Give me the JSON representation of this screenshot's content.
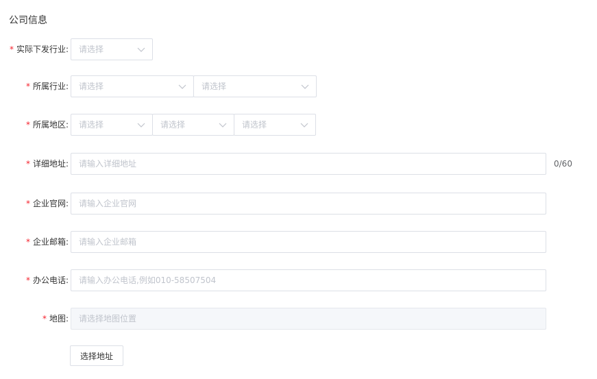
{
  "section": {
    "title": "公司信息"
  },
  "required_mark": "*",
  "industry_actual": {
    "label": "实际下发行业:",
    "select_placeholder": "请选择"
  },
  "industry": {
    "label": "所属行业:",
    "select1_placeholder": "请选择",
    "select2_placeholder": "请选择"
  },
  "region": {
    "label": "所属地区:",
    "select1_placeholder": "请选择",
    "select2_placeholder": "请选择",
    "select3_placeholder": "请选择"
  },
  "address": {
    "label": "详细地址:",
    "placeholder": "请输入详细地址",
    "counter": "0/60"
  },
  "website": {
    "label": "企业官网:",
    "placeholder": "请输入企业官网"
  },
  "email": {
    "label": "企业邮箱:",
    "placeholder": "请输入企业邮箱"
  },
  "phone": {
    "label": "办公电话:",
    "placeholder": "请输入办公电话,例如010-58507504"
  },
  "map": {
    "label": "地图:",
    "placeholder": "请选择地图位置",
    "button_label": "选择地址"
  },
  "colors": {
    "required": "#f5222d",
    "border": "#dcdfe6",
    "placeholder": "#c0c4cc",
    "disabled_bg": "#f5f7fa"
  },
  "icons": {
    "select_arrow": "chevron-down-icon"
  }
}
